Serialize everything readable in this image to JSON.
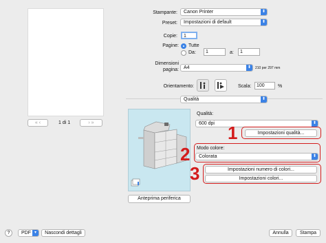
{
  "preview": {
    "page_counter": "1 di 1",
    "prev_label": "«  ‹",
    "next_label": "›  »"
  },
  "printer": {
    "label": "Stampante:",
    "value": "Canon Printer"
  },
  "preset": {
    "label": "Preset:",
    "value": "Impostazioni di default"
  },
  "copies": {
    "label": "Copie:",
    "value": "1"
  },
  "pages": {
    "label": "Pagine:",
    "all_label": "Tutte",
    "from_label": "Da:",
    "from_value": "1",
    "to_label": "a:",
    "to_value": "1"
  },
  "paper": {
    "label_line1": "Dimensioni",
    "label_line2": "pagina:",
    "value": "A4",
    "size_note": "210 per 297 mm"
  },
  "orientation": {
    "label": "Orientamento:"
  },
  "scale": {
    "label": "Scala:",
    "value": "100",
    "unit": "%"
  },
  "section_popup": {
    "value": "Qualità"
  },
  "quality": {
    "label": "Qualità:",
    "value": "600 dpi",
    "settings_button": "Impostazioni qualità..."
  },
  "color_mode": {
    "label": "Modo colore:",
    "value": "Colorata",
    "color_number_button": "Impostazioni numero di colori...",
    "color_settings_button": "Impostazioni colori..."
  },
  "callouts": [
    "1",
    "2",
    "3"
  ],
  "device_preview_button": "Anteprima periferica",
  "footer": {
    "help": "?",
    "pdf": "PDF",
    "hide_details": "Nascondi dettagli",
    "cancel": "Annulla",
    "print": "Stampa"
  },
  "colors": {
    "accent": "#3b82e6",
    "callout": "#d31c1c",
    "panel": "#c9e7f0"
  }
}
